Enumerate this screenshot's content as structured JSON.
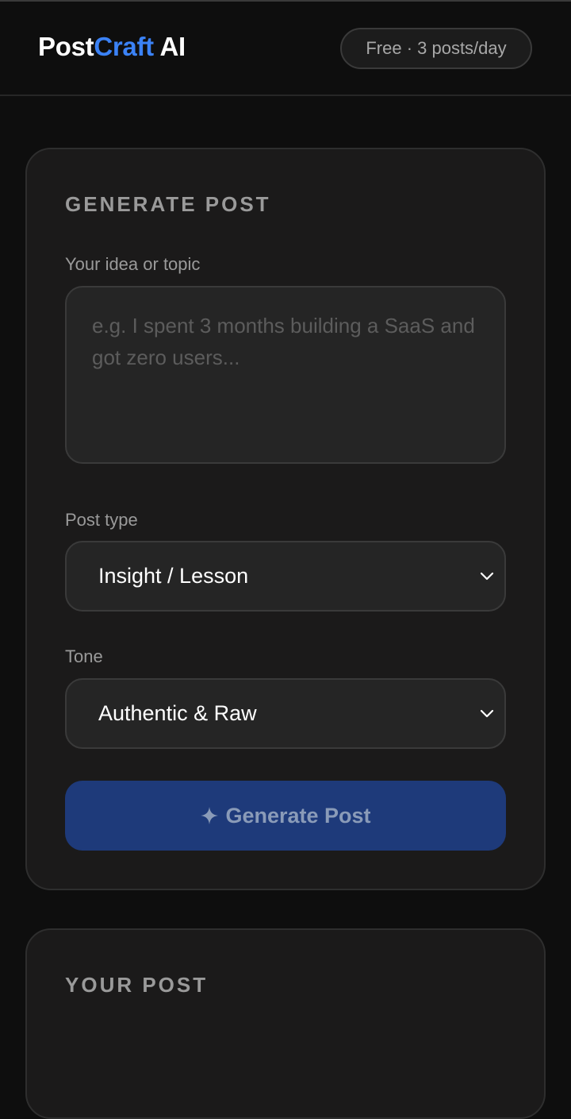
{
  "app": {
    "logo_part1": "Post",
    "logo_part2": "Craft",
    "logo_part3": " AI",
    "plan_badge": "Free · 3 posts/day"
  },
  "generate": {
    "title": "GENERATE POST",
    "idea_label": "Your idea or topic",
    "idea_value": "",
    "idea_placeholder": "e.g. I spent 3 months building a SaaS and got zero users...",
    "post_type_label": "Post type",
    "post_type_selected": "Insight / Lesson",
    "tone_label": "Tone",
    "tone_selected": "Authentic & Raw",
    "button_label": "Generate Post"
  },
  "output": {
    "title": "YOUR POST"
  },
  "colors": {
    "accent": "#3b82f6",
    "button_bg": "#1e3a7a",
    "card_bg": "#1b1a1a",
    "page_bg": "#0e0e0e"
  },
  "icons": {
    "select_arrow": "chevron-down-icon",
    "button_icon": "sparkle-icon"
  }
}
